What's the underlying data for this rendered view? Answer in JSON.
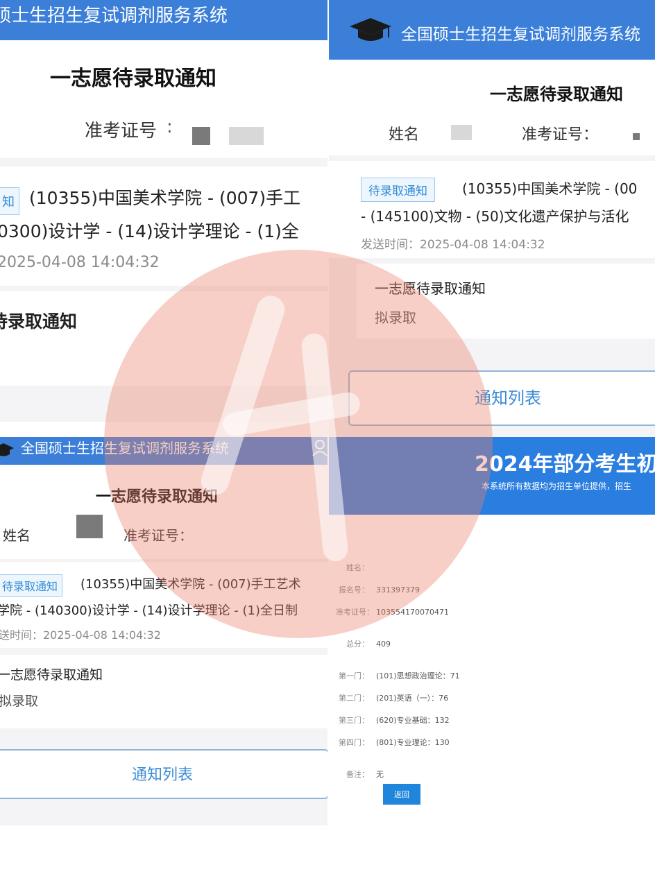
{
  "system_title": "全国硕士生招生复试调剂服务系统",
  "system_title_partial": "硕士生招生复试调剂服务系统",
  "notice_title": "一志愿待录取通知",
  "name_label": "姓名",
  "name_label_garbled": "姓名",
  "exam_no_label": "准考证号：",
  "exam_no_label_spaced": "准考证号",
  "badge": "待录取通知",
  "badge_partial": "知",
  "panel1": {
    "line1": "(10355)中国美术学院 - (007)手工",
    "line2": "0300)设计学 - (14)设计学理论 - (1)全",
    "time": "2025-04-08 14:04:32",
    "section_title": "待录取通知"
  },
  "panel2": {
    "line1": "(10355)中国美术学院 - (00",
    "line2": "- (145100)文物 - (50)文化遗产保护与活化",
    "time": "发送时间：2025-04-08 14:04:32",
    "section_title": "一志愿待录取通知",
    "section_value": "拟录取",
    "list_button": "通知列表"
  },
  "panel3": {
    "line1": "(10355)中国美术学院 - (007)手工艺术",
    "line2": "学院 - (140300)设计学 - (14)设计学理论 - (1)全日制",
    "time": "送时间：2025-04-08 14:04:32",
    "section_title": "一志愿待录取通知",
    "section_value": "拟录取",
    "list_button": "通知列表"
  },
  "panel4": {
    "banner_title": "2024年部分考生初",
    "banner_sub": "本系统所有数据均为招生单位提供，招生",
    "rows": [
      {
        "key": "姓名：",
        "value": "",
        "gap": false
      },
      {
        "key": "报名号：",
        "value": "331397379",
        "gap": false
      },
      {
        "key": "准考证号：",
        "value": "103554170070471",
        "gap": false
      },
      {
        "key": "总分：",
        "value": "409",
        "gap": true
      },
      {
        "key": "第一门：",
        "value": "(101)思想政治理论：71",
        "gap": true
      },
      {
        "key": "第二门：",
        "value": "(201)英语（一）：76",
        "gap": false
      },
      {
        "key": "第三门：",
        "value": "(620)专业基础：132",
        "gap": false
      },
      {
        "key": "第四门：",
        "value": "(801)专业理论：130",
        "gap": false
      },
      {
        "key": "备注：",
        "value": "无",
        "gap": true
      }
    ],
    "return_button": "返回"
  },
  "colors": {
    "header_blue": "#3b7fd9",
    "badge_blue": "#2f8ad8",
    "button_blue": "#1f86dc",
    "watermark": "#eb8269"
  },
  "icons": {
    "grad_cap": "graduation-cap-icon",
    "user": "user-icon"
  }
}
